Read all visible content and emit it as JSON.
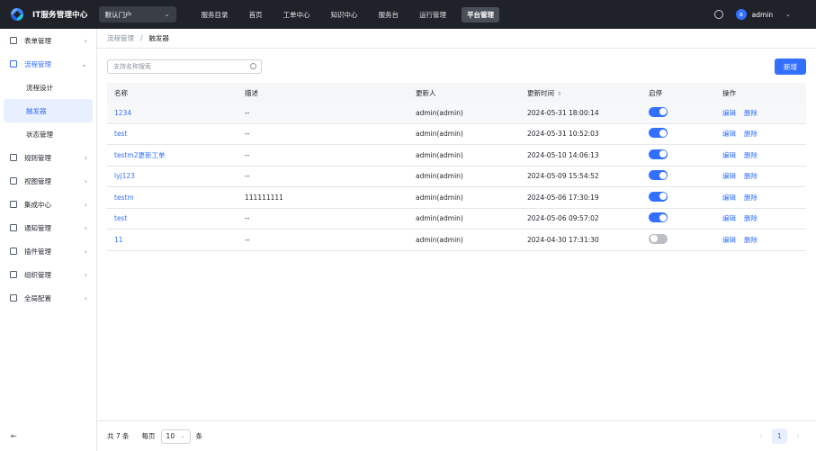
{
  "header": {
    "app_title": "IT服务管理中心",
    "portal": "默认门户",
    "nav": [
      {
        "label": "服务目录",
        "active": false
      },
      {
        "label": "首页",
        "active": false
      },
      {
        "label": "工单中心",
        "active": false
      },
      {
        "label": "知识中心",
        "active": false
      },
      {
        "label": "服务台",
        "active": false
      },
      {
        "label": "运行管理",
        "active": false
      },
      {
        "label": "平台管理",
        "active": true
      }
    ],
    "user": {
      "initial": "a",
      "name": "admin"
    }
  },
  "sidebar": {
    "items": [
      {
        "label": "表单管理",
        "icon": "form-icon",
        "state": "collapsed"
      },
      {
        "label": "流程管理",
        "icon": "process-icon",
        "state": "expanded",
        "children": [
          {
            "label": "流程设计",
            "active": false
          },
          {
            "label": "触发器",
            "active": true
          },
          {
            "label": "状态管理",
            "active": false
          }
        ]
      },
      {
        "label": "规则管理",
        "icon": "rule-icon",
        "state": "collapsed"
      },
      {
        "label": "视图管理",
        "icon": "view-icon",
        "state": "collapsed"
      },
      {
        "label": "集成中心",
        "icon": "integration-icon",
        "state": "collapsed"
      },
      {
        "label": "通知管理",
        "icon": "bell-icon",
        "state": "collapsed"
      },
      {
        "label": "插件管理",
        "icon": "plugin-icon",
        "state": "collapsed"
      },
      {
        "label": "组织管理",
        "icon": "org-icon",
        "state": "collapsed"
      },
      {
        "label": "全局配置",
        "icon": "settings-icon",
        "state": "collapsed"
      }
    ]
  },
  "breadcrumb": {
    "parent": "流程管理",
    "separator": "/",
    "current": "触发器"
  },
  "search": {
    "placeholder": "支持名称搜索"
  },
  "new_button": "新增",
  "table": {
    "columns": [
      "名称",
      "描述",
      "更新人",
      "更新时间",
      "启停",
      "操作"
    ],
    "rows": [
      {
        "name": "1234",
        "desc": "--",
        "updater": "admin(admin)",
        "time": "2024-05-31 18:00:14",
        "enabled": true
      },
      {
        "name": "test",
        "desc": "--",
        "updater": "admin(admin)",
        "time": "2024-05-31 10:52:03",
        "enabled": true
      },
      {
        "name": "testm2更新工单",
        "desc": "--",
        "updater": "admin(admin)",
        "time": "2024-05-10 14:06:13",
        "enabled": true
      },
      {
        "name": "lyj123",
        "desc": "--",
        "updater": "admin(admin)",
        "time": "2024-05-09 15:54:52",
        "enabled": true
      },
      {
        "name": "testm",
        "desc": "111111111",
        "updater": "admin(admin)",
        "time": "2024-05-06 17:30:19",
        "enabled": true
      },
      {
        "name": "test",
        "desc": "--",
        "updater": "admin(admin)",
        "time": "2024-05-06 09:57:02",
        "enabled": true
      },
      {
        "name": "11",
        "desc": "--",
        "updater": "admin(admin)",
        "time": "2024-04-30 17:31:30",
        "enabled": false
      }
    ],
    "actions": {
      "edit": "编辑",
      "delete": "删除"
    }
  },
  "footer": {
    "total": "共 7 条",
    "per_page_prefix": "每页",
    "page_size": "10",
    "per_page_suffix": "条",
    "current_page": "1"
  },
  "colors": {
    "primary": "#3370ff",
    "topbar": "#1f2329",
    "toggle_off": "#bbbfc4"
  }
}
